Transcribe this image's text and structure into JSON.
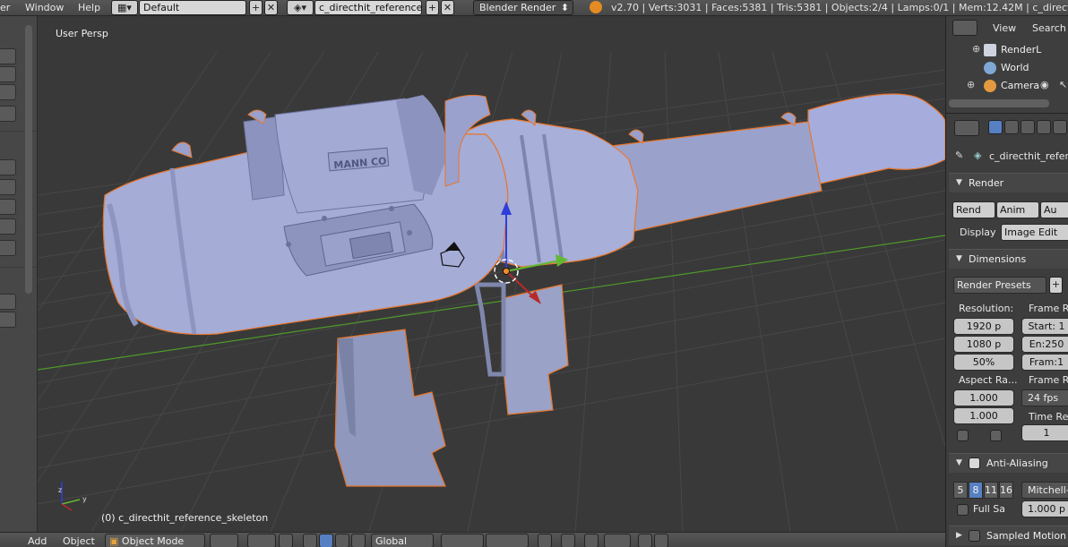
{
  "topbar": {
    "menus": [
      "er",
      "Window",
      "Help"
    ],
    "screen_layout": "Default",
    "scene_name": "c_directhit_reference",
    "render_engine": "Blender Render",
    "stats": "v2.70 | Verts:3031 | Faces:5381 | Tris:5381 | Objects:2/4 | Lamps:0/1 | Mem:12.42M | c_directhit_ref"
  },
  "viewport": {
    "view_name": "User Persp",
    "object_info": "(0) c_directhit_reference_skeleton",
    "stamp_text": "MANN CO"
  },
  "bottombar": {
    "menus": [
      "Add",
      "Object"
    ],
    "mode": "Object Mode",
    "orientation": "Global"
  },
  "outliner": {
    "header": [
      "View",
      "Search"
    ],
    "items": [
      {
        "name": "RenderL",
        "icon": "render-layers-icon"
      },
      {
        "name": "World",
        "icon": "world-icon"
      },
      {
        "name": "Camera",
        "icon": "camera-icon"
      }
    ]
  },
  "properties": {
    "object_path": "c_directhit_refere",
    "render_panel": {
      "title": "Render",
      "buttons": [
        "Rend",
        "Anim",
        "Au"
      ],
      "display_label": "Display",
      "display_value": "Image Edit"
    },
    "dimensions_panel": {
      "title": "Dimensions",
      "presets": "Render Presets",
      "resolution_label": "Resolution:",
      "res_x": "1920 p",
      "res_y": "1080 p",
      "res_pct": "50%",
      "frame_range_label": "Frame Ra",
      "start": "Start: 1",
      "end": "En:250",
      "frame": "Fram:1",
      "aspect_label": "Aspect Ra...",
      "aspect_x": "1.000",
      "aspect_y": "1.000",
      "frame_rate_label": "Frame Ra",
      "fps": "24 fps",
      "time_remap_label": "Time Ren",
      "time_value": "1"
    },
    "aa_panel": {
      "title": "Anti-Aliasing",
      "samples": [
        "5",
        "8",
        "11",
        "16"
      ],
      "selected_sample": "8",
      "filter": "Mitchell-",
      "full_sample_label": "Full Sa",
      "filter_size": "1.000 p"
    },
    "motion_panel": {
      "title": "Sampled Motion"
    }
  },
  "colors": {
    "selection_outline": "#e8752a",
    "model": "#9aa3c8",
    "background": "#393939",
    "x_axis": "#b82a2a",
    "y_axis": "#62b832",
    "z_axis": "#2f3dd8"
  }
}
